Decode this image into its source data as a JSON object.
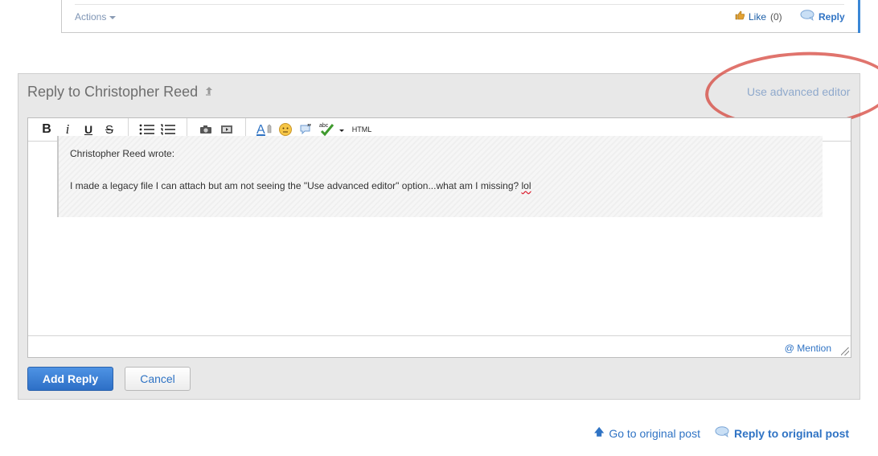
{
  "post": {
    "actions_label": "Actions",
    "like_label": "Like",
    "like_count": "(0)",
    "reply_label": "Reply"
  },
  "reply_panel": {
    "title": "Reply to Christopher Reed",
    "advanced_editor_link": "Use advanced editor"
  },
  "toolbar": {
    "bold": "B",
    "italic": "i",
    "underline": "U",
    "strike": "S",
    "html": "HTML",
    "spell_label": "abc"
  },
  "quote": {
    "author_line": "Christopher Reed wrote:",
    "text_main": "I made a legacy file I can attach but am not seeing the \"Use advanced editor\" option...what am I missing? ",
    "text_squiggle": "lol"
  },
  "editor_footer": {
    "mention_label": "@ Mention"
  },
  "buttons": {
    "add_reply": "Add Reply",
    "cancel": "Cancel"
  },
  "bottom": {
    "go_to_original": "Go to original post",
    "reply_to_original": "Reply to original post"
  },
  "colors": {
    "link": "#2f73c4",
    "primary_button": "#2d6fc6",
    "annotation_circle": "#d6463c",
    "panel_bg": "#e8e8e8"
  }
}
